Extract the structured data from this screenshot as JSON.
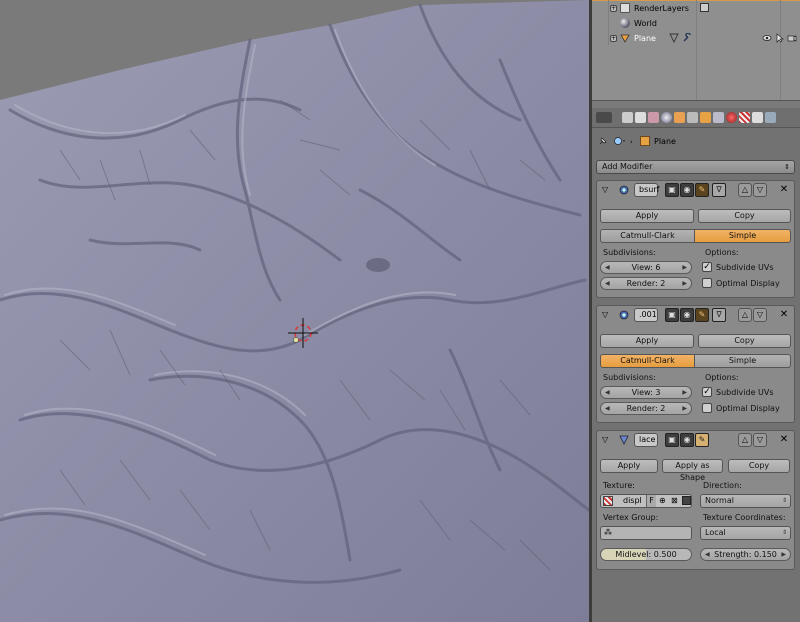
{
  "outliner": {
    "rows": [
      {
        "label": "RenderLayers",
        "expander": "+"
      },
      {
        "label": "World"
      },
      {
        "label": "Plane",
        "expander": "+"
      }
    ]
  },
  "breadcrumb": {
    "object": "Plane"
  },
  "add_modifier": {
    "label": "Add Modifier"
  },
  "modifiers": [
    {
      "name": "bsurf",
      "apply": "Apply",
      "copy": "Copy",
      "modes": [
        "Catmull-Clark",
        "Simple"
      ],
      "active_mode": "Simple",
      "subdivisions_label": "Subdivisions:",
      "options_label": "Options:",
      "view": "View: 6",
      "render": "Render: 2",
      "subdivide_uvs": {
        "label": "Subdivide UVs",
        "checked": true
      },
      "optimal_display": {
        "label": "Optimal Display",
        "checked": false
      }
    },
    {
      "name": ".001",
      "apply": "Apply",
      "copy": "Copy",
      "modes": [
        "Catmull-Clark",
        "Simple"
      ],
      "active_mode": "Catmull-Clark",
      "subdivisions_label": "Subdivisions:",
      "options_label": "Options:",
      "view": "View: 3",
      "render": "Render: 2",
      "subdivide_uvs": {
        "label": "Subdivide UVs",
        "checked": true
      },
      "optimal_display": {
        "label": "Optimal Display",
        "checked": false
      }
    },
    {
      "name": "lace",
      "apply": "Apply",
      "apply_shape": "Apply as Shape",
      "copy": "Copy",
      "texture_label": "Texture:",
      "texture_name": "displ",
      "texture_f": "F",
      "direction_label": "Direction:",
      "direction": "Normal",
      "vertex_group_label": "Vertex Group:",
      "tex_coords_label": "Texture Coordinates:",
      "tex_coords": "Local",
      "midlevel": "Midlevel: 0.500",
      "strength": "Strength: 0.150"
    }
  ],
  "colors": {
    "accent": "#e8a246",
    "terrain": "#8d8da6",
    "panel_bg": "#8a8a8a"
  }
}
